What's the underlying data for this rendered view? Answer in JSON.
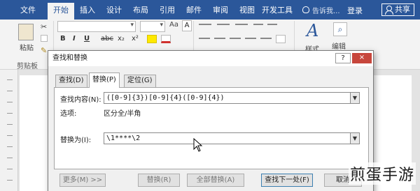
{
  "ribbon": {
    "tabs": [
      "文件",
      "开始",
      "插入",
      "设计",
      "布局",
      "引用",
      "邮件",
      "审阅",
      "视图",
      "开发工具"
    ],
    "active_tab": "开始",
    "tell_me": "告诉我...",
    "login": "登录",
    "share": "共享",
    "paste_label": "粘贴",
    "clipboard_group": "剪贴板",
    "styles_label": "样式",
    "edit_label": "编辑",
    "font_buttons": [
      "B",
      "I",
      "U",
      "abc",
      "x₂",
      "x²"
    ],
    "change_case": "Aa",
    "clear_format": "A",
    "find_icon": "search-icon"
  },
  "dialog": {
    "title": "查找和替换",
    "help": "?",
    "close": "×",
    "tabs": [
      "查找(D)",
      "替换(P)",
      "定位(G)"
    ],
    "active_tab": "替换(P)",
    "find_label": "查找内容(N):",
    "find_value": "([0-9]{3})[0-9]{4}([0-9]{4})",
    "options_label": "选项:",
    "options_value": "区分全/半角",
    "replace_label": "替换为(I):",
    "replace_value": "\\1****\\2",
    "buttons": {
      "more": "更多(M) >>",
      "replace": "替换(R)",
      "replace_all": "全部替换(A)",
      "find_next": "查找下一处(F)",
      "cancel": "取消"
    }
  },
  "watermark": "煎蛋手游",
  "colors": {
    "accent": "#2b579a",
    "close": "#c7463c"
  }
}
